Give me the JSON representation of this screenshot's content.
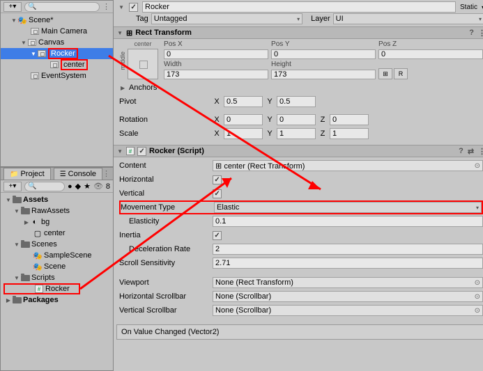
{
  "hierarchy": {
    "scene": "Scene*",
    "items": [
      "Main Camera",
      "Canvas",
      "Rocker",
      "center",
      "EventSystem"
    ]
  },
  "project": {
    "tabs": {
      "project": "Project",
      "console": "Console"
    },
    "search_icon_count": "8",
    "tree": {
      "assets": "Assets",
      "rawassets": "RawAssets",
      "bg": "bg",
      "center": "center",
      "scenes": "Scenes",
      "samplescene": "SampleScene",
      "scene": "Scene",
      "scripts": "Scripts",
      "rocker": "Rocker",
      "packages": "Packages"
    }
  },
  "inspector": {
    "name": "Rocker",
    "static": "Static",
    "tag_label": "Tag",
    "tag": "Untagged",
    "layer_label": "Layer",
    "layer": "UI",
    "rect": {
      "title": "Rect Transform",
      "anchor_h": "center",
      "anchor_v": "middle",
      "posx_h": "Pos X",
      "posy_h": "Pos Y",
      "posz_h": "Pos Z",
      "posx": "0",
      "posy": "0",
      "posz": "0",
      "width_h": "Width",
      "height_h": "Height",
      "width": "173",
      "height": "173",
      "r_btn": "R",
      "anchors": "Anchors",
      "pivot": "Pivot",
      "pivot_x": "0.5",
      "pivot_y": "0.5",
      "rotation": "Rotation",
      "rot_x": "0",
      "rot_y": "0",
      "rot_z": "0",
      "scale": "Scale",
      "scale_x": "1",
      "scale_y": "1",
      "scale_z": "1"
    },
    "rocker": {
      "title": "Rocker (Script)",
      "content_l": "Content",
      "content": "center (Rect Transform)",
      "horizontal_l": "Horizontal",
      "vertical_l": "Vertical",
      "movement_l": "Movement Type",
      "movement": "Elastic",
      "elasticity_l": "Elasticity",
      "elasticity": "0.1",
      "inertia_l": "Inertia",
      "decel_l": "Deceleration Rate",
      "decel": "2",
      "scroll_l": "Scroll Sensitivity",
      "scroll": "2.71",
      "viewport_l": "Viewport",
      "viewport": "None (Rect Transform)",
      "hscroll_l": "Horizontal Scrollbar",
      "hscroll": "None (Scrollbar)",
      "vscroll_l": "Vertical Scrollbar",
      "vscroll": "None (Scrollbar)",
      "event": "On Value Changed (Vector2)"
    }
  }
}
